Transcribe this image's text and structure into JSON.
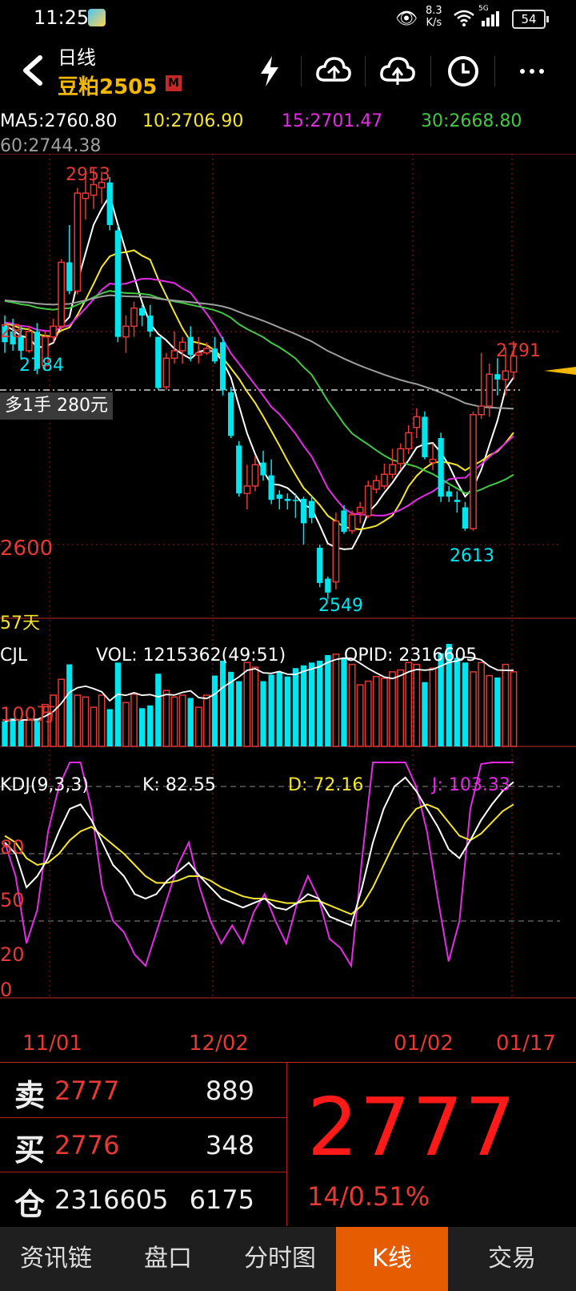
{
  "status_bar": {
    "time": "11:25",
    "net_speed_value": "8.3",
    "net_speed_unit": "K/s",
    "signal_label": "5G",
    "battery": "54"
  },
  "header": {
    "period": "日线",
    "symbol": "豆粕2505",
    "badge": "M",
    "icons": [
      "back-arrow-icon",
      "lightning-icon",
      "cloud-sync-icon",
      "cloud-upload-icon",
      "clock-icon",
      "more-icon"
    ]
  },
  "ma_legend": {
    "ma5": "MA5:2760.80",
    "ma10": "10:2706.90",
    "ma15": "15:2701.47",
    "ma30": "30:2668.80",
    "ma60": "60:2744.38"
  },
  "colors": {
    "up": "#e53935",
    "down": "#00e5ee",
    "ma5": "#ffffff",
    "ma10": "#f5e62b",
    "ma15": "#e62be6",
    "ma30": "#43c843",
    "ma60": "#9e9e9e"
  },
  "price_chart": {
    "y_labels": {
      "upper": "28",
      "lower": "2600"
    },
    "annotations": {
      "high": "2953",
      "left_low": "2784",
      "low": "2549",
      "recent_low": "2613",
      "recent_high": "2791"
    },
    "days_label": "57天",
    "position_tag": "多1手  280元"
  },
  "volume_panel": {
    "title": "CJL",
    "vol": "VOL: 1215362(49:51)",
    "opid": "OPID: 2316605",
    "y_label": "100万"
  },
  "kdj_panel": {
    "title": "KDJ(9,3,3)",
    "k": "K: 82.55",
    "d": "D: 72.16",
    "j": "J: 103.33",
    "levels": [
      "80",
      "50",
      "20",
      "0"
    ]
  },
  "x_axis": [
    "11/01",
    "12/02",
    "01/02",
    "01/17"
  ],
  "quote": {
    "sell_label": "卖",
    "sell_price": "2777",
    "sell_volume": "889",
    "buy_label": "买",
    "buy_price": "2776",
    "buy_volume": "348",
    "oi_label": "仓",
    "open_interest": "2316605",
    "oi_change": "6175",
    "last_price": "2777",
    "change": "14/0.51%"
  },
  "tabs": [
    {
      "label": "资讯链",
      "active": false
    },
    {
      "label": "盘口",
      "active": false
    },
    {
      "label": "分时图",
      "active": false
    },
    {
      "label": "K线",
      "active": true
    },
    {
      "label": "交易",
      "active": false
    }
  ],
  "chart_data": {
    "type": "candlestick",
    "price_scale": {
      "label_upper": 2800,
      "label_lower": 2600
    },
    "candles": [
      {
        "o": 2805,
        "h": 2815,
        "l": 2780,
        "c": 2790
      },
      {
        "o": 2800,
        "h": 2812,
        "l": 2782,
        "c": 2788
      },
      {
        "o": 2795,
        "h": 2805,
        "l": 2775,
        "c": 2782
      },
      {
        "o": 2782,
        "h": 2805,
        "l": 2780,
        "c": 2800
      },
      {
        "o": 2800,
        "h": 2808,
        "l": 2760,
        "c": 2765
      },
      {
        "o": 2768,
        "h": 2800,
        "l": 2765,
        "c": 2795
      },
      {
        "o": 2795,
        "h": 2812,
        "l": 2790,
        "c": 2805
      },
      {
        "o": 2805,
        "h": 2868,
        "l": 2802,
        "c": 2865
      },
      {
        "o": 2865,
        "h": 2900,
        "l": 2835,
        "c": 2838
      },
      {
        "o": 2838,
        "h": 2935,
        "l": 2835,
        "c": 2930
      },
      {
        "o": 2925,
        "h": 2945,
        "l": 2905,
        "c": 2930
      },
      {
        "o": 2928,
        "h": 2953,
        "l": 2915,
        "c": 2938
      },
      {
        "o": 2935,
        "h": 2950,
        "l": 2920,
        "c": 2940
      },
      {
        "o": 2940,
        "h": 2945,
        "l": 2895,
        "c": 2900
      },
      {
        "o": 2895,
        "h": 2900,
        "l": 2790,
        "c": 2795
      },
      {
        "o": 2795,
        "h": 2815,
        "l": 2780,
        "c": 2805
      },
      {
        "o": 2805,
        "h": 2828,
        "l": 2795,
        "c": 2822
      },
      {
        "o": 2822,
        "h": 2825,
        "l": 2805,
        "c": 2815
      },
      {
        "o": 2815,
        "h": 2825,
        "l": 2795,
        "c": 2800
      },
      {
        "o": 2795,
        "h": 2795,
        "l": 2745,
        "c": 2747
      },
      {
        "o": 2748,
        "h": 2780,
        "l": 2745,
        "c": 2775
      },
      {
        "o": 2775,
        "h": 2800,
        "l": 2770,
        "c": 2782
      },
      {
        "o": 2782,
        "h": 2795,
        "l": 2770,
        "c": 2790
      },
      {
        "o": 2795,
        "h": 2805,
        "l": 2772,
        "c": 2778
      },
      {
        "o": 2778,
        "h": 2795,
        "l": 2770,
        "c": 2780
      },
      {
        "o": 2780,
        "h": 2790,
        "l": 2778,
        "c": 2784
      },
      {
        "o": 2784,
        "h": 2795,
        "l": 2770,
        "c": 2772
      },
      {
        "o": 2790,
        "h": 2795,
        "l": 2740,
        "c": 2745
      },
      {
        "o": 2743,
        "h": 2748,
        "l": 2700,
        "c": 2702
      },
      {
        "o": 2693,
        "h": 2697,
        "l": 2645,
        "c": 2648
      },
      {
        "o": 2648,
        "h": 2675,
        "l": 2633,
        "c": 2655
      },
      {
        "o": 2655,
        "h": 2683,
        "l": 2650,
        "c": 2675
      },
      {
        "o": 2677,
        "h": 2688,
        "l": 2660,
        "c": 2665
      },
      {
        "o": 2665,
        "h": 2680,
        "l": 2638,
        "c": 2642
      },
      {
        "o": 2647,
        "h": 2651,
        "l": 2633,
        "c": 2643
      },
      {
        "o": 2643,
        "h": 2648,
        "l": 2633,
        "c": 2641
      },
      {
        "o": 2642,
        "h": 2648,
        "l": 2625,
        "c": 2641
      },
      {
        "o": 2643,
        "h": 2645,
        "l": 2600,
        "c": 2620
      },
      {
        "o": 2641,
        "h": 2646,
        "l": 2620,
        "c": 2625
      },
      {
        "o": 2597,
        "h": 2600,
        "l": 2560,
        "c": 2564
      },
      {
        "o": 2568,
        "h": 2570,
        "l": 2549,
        "c": 2555
      },
      {
        "o": 2565,
        "h": 2630,
        "l": 2558,
        "c": 2622
      },
      {
        "o": 2632,
        "h": 2637,
        "l": 2610,
        "c": 2612
      },
      {
        "o": 2613,
        "h": 2632,
        "l": 2610,
        "c": 2628
      },
      {
        "o": 2630,
        "h": 2640,
        "l": 2620,
        "c": 2635
      },
      {
        "o": 2627,
        "h": 2660,
        "l": 2625,
        "c": 2655
      },
      {
        "o": 2652,
        "h": 2665,
        "l": 2648,
        "c": 2660
      },
      {
        "o": 2655,
        "h": 2676,
        "l": 2652,
        "c": 2666
      },
      {
        "o": 2666,
        "h": 2690,
        "l": 2662,
        "c": 2675
      },
      {
        "o": 2676,
        "h": 2695,
        "l": 2670,
        "c": 2690
      },
      {
        "o": 2690,
        "h": 2712,
        "l": 2685,
        "c": 2705
      },
      {
        "o": 2710,
        "h": 2728,
        "l": 2700,
        "c": 2720
      },
      {
        "o": 2720,
        "h": 2725,
        "l": 2680,
        "c": 2682
      },
      {
        "o": 2677,
        "h": 2695,
        "l": 2670,
        "c": 2680
      },
      {
        "o": 2700,
        "h": 2705,
        "l": 2640,
        "c": 2645
      },
      {
        "o": 2650,
        "h": 2655,
        "l": 2640,
        "c": 2645
      },
      {
        "o": 2642,
        "h": 2650,
        "l": 2630,
        "c": 2640
      },
      {
        "o": 2635,
        "h": 2640,
        "l": 2613,
        "c": 2615
      },
      {
        "o": 2615,
        "h": 2725,
        "l": 2613,
        "c": 2722
      },
      {
        "o": 2722,
        "h": 2780,
        "l": 2718,
        "c": 2730
      },
      {
        "o": 2730,
        "h": 2770,
        "l": 2720,
        "c": 2760
      },
      {
        "o": 2760,
        "h": 2775,
        "l": 2740,
        "c": 2755
      },
      {
        "o": 2755,
        "h": 2785,
        "l": 2740,
        "c": 2763
      },
      {
        "o": 2762,
        "h": 2791,
        "l": 2755,
        "c": 2777
      }
    ],
    "volume_note": "relative volume bars per candle",
    "volume": [
      27,
      30,
      28,
      29,
      30,
      45,
      55,
      72,
      88,
      55,
      53,
      42,
      55,
      40,
      90,
      47,
      56,
      41,
      44,
      78,
      60,
      53,
      55,
      52,
      42,
      55,
      76,
      92,
      80,
      70,
      90,
      85,
      70,
      77,
      80,
      75,
      84,
      87,
      90,
      92,
      98,
      99,
      95,
      88,
      66,
      70,
      75,
      73,
      80,
      82,
      90,
      88,
      69,
      84,
      100,
      110,
      95,
      90,
      80,
      90,
      76,
      74,
      88,
      80
    ],
    "kdj": {
      "k": [
        55,
        50,
        35,
        40,
        48,
        60,
        70,
        72,
        65,
        55,
        45,
        40,
        32,
        30,
        32,
        38,
        42,
        46,
        40,
        35,
        30,
        28,
        26,
        28,
        30,
        26,
        25,
        28,
        32,
        30,
        22,
        20,
        18,
        35,
        55,
        70,
        80,
        84,
        78,
        70,
        62,
        52,
        48,
        56,
        65,
        72,
        78,
        82
      ],
      "d": [
        58,
        55,
        48,
        45,
        46,
        50,
        56,
        60,
        62,
        58,
        54,
        50,
        45,
        40,
        37,
        37,
        38,
        40,
        40,
        38,
        35,
        33,
        31,
        30,
        30,
        29,
        28,
        28,
        29,
        29,
        27,
        25,
        23,
        27,
        35,
        45,
        55,
        64,
        70,
        72,
        70,
        64,
        58,
        56,
        59,
        64,
        69,
        72
      ],
      "j": [
        55,
        40,
        10,
        25,
        60,
        80,
        95,
        96,
        70,
        35,
        20,
        15,
        5,
        0,
        15,
        30,
        45,
        55,
        35,
        20,
        10,
        18,
        10,
        24,
        32,
        20,
        10,
        28,
        40,
        30,
        12,
        8,
        0,
        48,
        100,
        118,
        110,
        98,
        80,
        60,
        30,
        2,
        20,
        70,
        90,
        95,
        100,
        103
      ]
    }
  }
}
